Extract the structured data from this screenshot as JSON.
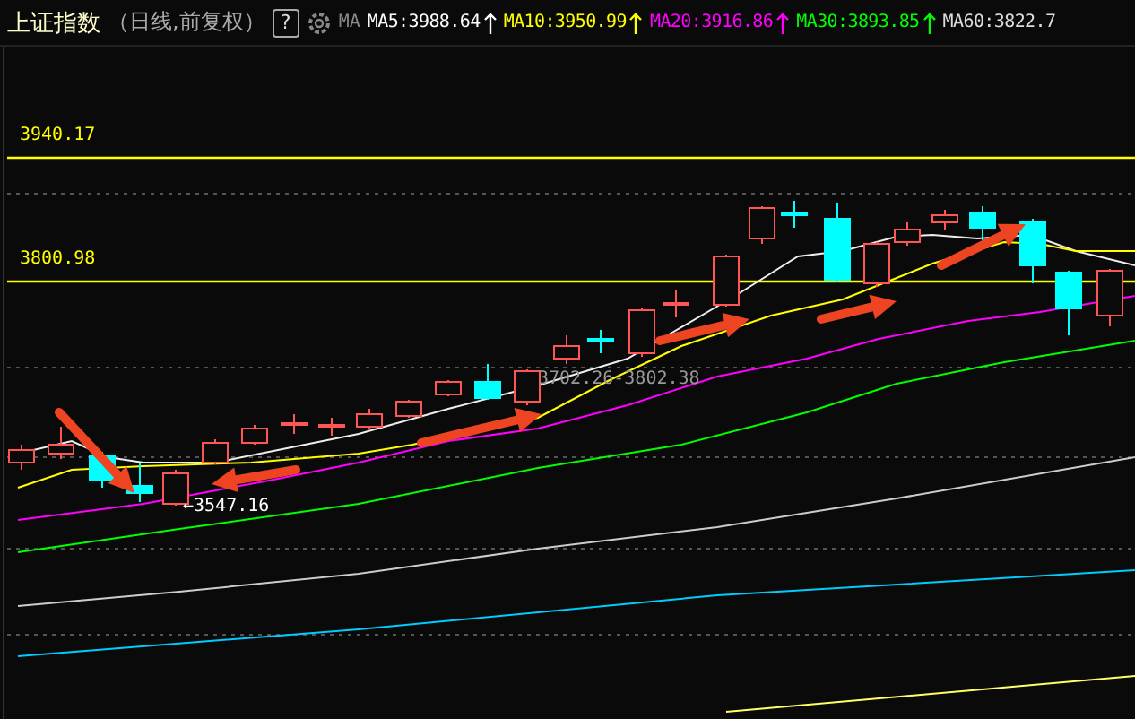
{
  "header": {
    "title": "上证指数",
    "subtitle": "（日线,前复权）",
    "help": "?",
    "ma_label": "MA",
    "ma_items": [
      {
        "text": "MA5:3988.64",
        "color": "#ffffff"
      },
      {
        "text": "MA10:3950.99",
        "color": "#ffff00"
      },
      {
        "text": "MA20:3916.86",
        "color": "#ff00ff"
      },
      {
        "text": "MA30:3893.85",
        "color": "#00ff00"
      },
      {
        "text": "MA60:3822.7",
        "color": "#dddddd"
      }
    ]
  },
  "chart": {
    "price_lines": [
      {
        "label": "3940.17"
      },
      {
        "label": "3800.98"
      }
    ],
    "low_label": "←3547.16",
    "range_label": "3702.26-3802.38"
  }
}
